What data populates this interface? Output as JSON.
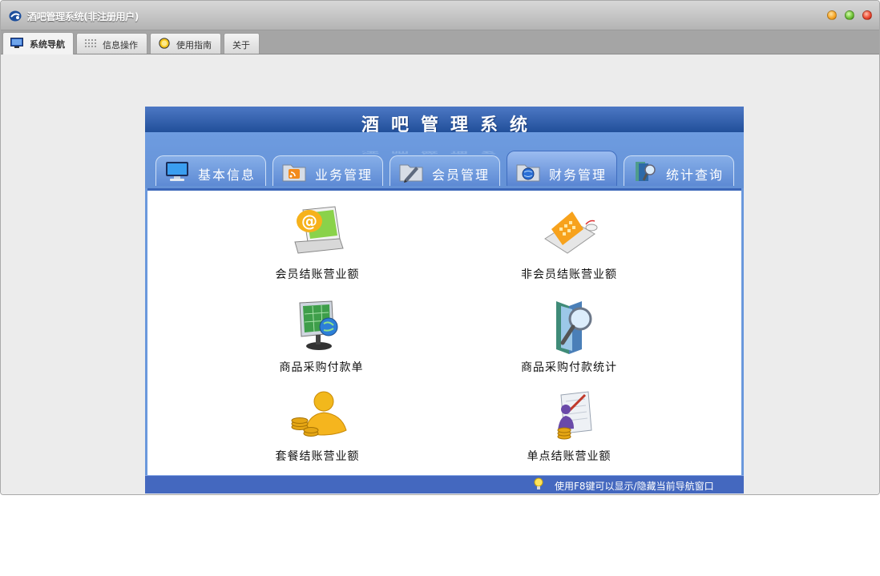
{
  "window": {
    "title": "酒吧管理系统(非注册用户)"
  },
  "tabs": [
    {
      "label": "系统导航",
      "icon": "monitor-icon",
      "active": true
    },
    {
      "label": "信息操作",
      "icon": "grid-icon",
      "active": false
    },
    {
      "label": "使用指南",
      "icon": "guide-icon",
      "active": false
    },
    {
      "label": "关于",
      "icon": "",
      "active": false
    }
  ],
  "panel": {
    "title": "酒吧管理系统",
    "tabs": [
      {
        "label": "基本信息",
        "icon": "computer-icon",
        "active": false
      },
      {
        "label": "业务管理",
        "icon": "folder-rss-icon",
        "active": false
      },
      {
        "label": "会员管理",
        "icon": "folder-pen-icon",
        "active": false
      },
      {
        "label": "财务管理",
        "icon": "folder-globe-icon",
        "active": true
      },
      {
        "label": "统计查询",
        "icon": "book-search-icon",
        "active": false
      }
    ],
    "items": [
      {
        "label": "会员结账营业额",
        "icon": "laptop-email-icon"
      },
      {
        "label": "非会员结账营业额",
        "icon": "laptop-calculator-icon"
      },
      {
        "label": "商品采购付款单",
        "icon": "monitor-globe-icon"
      },
      {
        "label": "商品采购付款统计",
        "icon": "book-magnifier-icon"
      },
      {
        "label": "套餐结账营业额",
        "icon": "user-coins-icon"
      },
      {
        "label": "单点结账营业额",
        "icon": "document-user-coins-icon"
      }
    ],
    "footer": "使用F8键可以显示/隐藏当前导航窗口"
  },
  "colors": {
    "panel_blue": "#6a98dc",
    "panel_header": "#214f9a",
    "footer_blue": "#4468bf"
  }
}
